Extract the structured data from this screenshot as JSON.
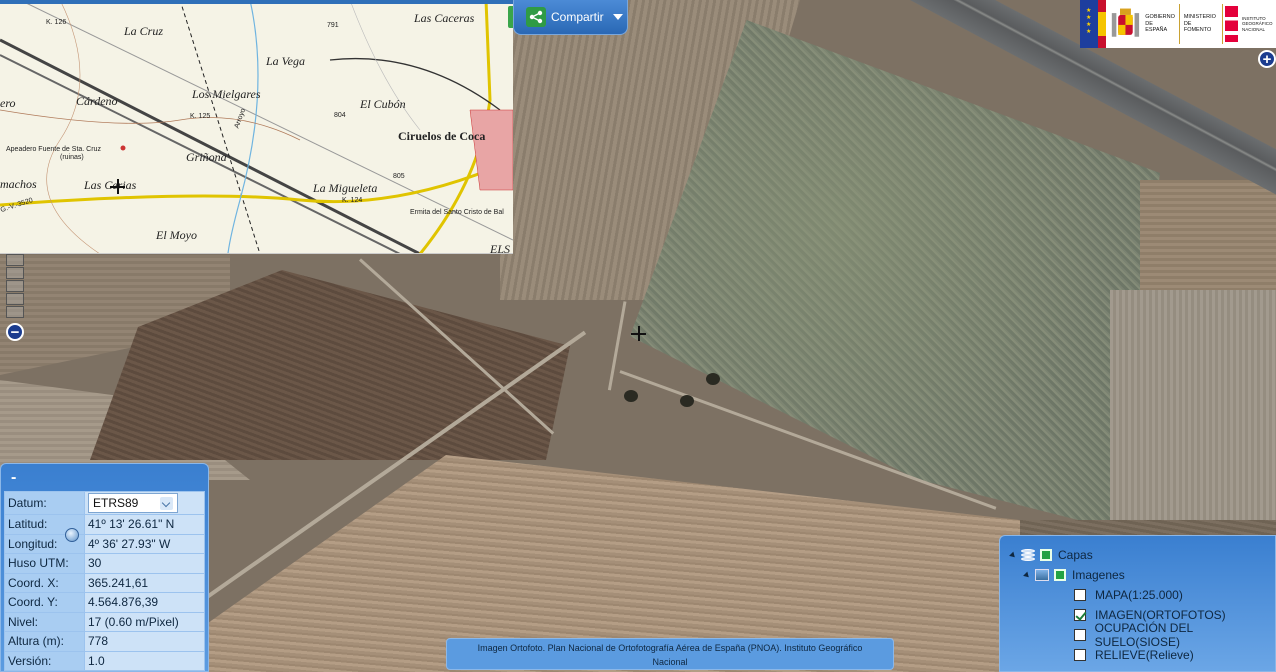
{
  "share": {
    "label": "Compartir",
    "icon": "share-icon"
  },
  "logos": {
    "gobierno": "GOBIERNO DE ESPAÑA",
    "ministerio": "MINISTERIO DE FOMENTO",
    "instituto": "INSTITUTO GEOGRÁFICO NACIONAL"
  },
  "zoom": {
    "in_label": "+",
    "out_label": "−"
  },
  "topo_labels": {
    "la_cruz": "La Cruz",
    "las_caceras": "Las Caceras",
    "la_vega": "La Vega",
    "los_mielgares": "Los Mielgares",
    "el_cubon": "El Cubón",
    "cardeno": "Cárdeno",
    "ciruelos": "Ciruelos de Coca",
    "apeadero": "Apeadero Fuente de Sta. Cruz",
    "ruinas": "(ruinas)",
    "grinona": "Griñona",
    "machos": "machos",
    "las_cerias": "Las Cerias",
    "la_migueleta": "La Migueleta",
    "el_moyo": "El Moyo",
    "ermita": "Ermita del Santo Cristo de Bal",
    "arroyo": "Arroyo",
    "els": "ELS",
    "ero": "ero",
    "k126": "K. 126",
    "k125": "K. 125",
    "k124": "K. 124",
    "h791": "791",
    "h804": "804",
    "h805": "805",
    "road_code": "G.-V.-3520"
  },
  "coords": {
    "toggle": "-",
    "datum_label": "Datum:",
    "datum_value": "ETRS89",
    "rows": [
      {
        "label": "Latitud:",
        "value": "41º 13' 26.61\" N"
      },
      {
        "label": "Longitud:",
        "value": "4º 36' 27.93\" W"
      },
      {
        "label": "Huso UTM:",
        "value": "30"
      },
      {
        "label": "Coord. X:",
        "value": "365.241,61"
      },
      {
        "label": "Coord. Y:",
        "value": "4.564.876,39"
      },
      {
        "label": "Nivel:",
        "value": "17 (0.60 m/Pixel)"
      },
      {
        "label": "Altura (m):",
        "value": "778"
      },
      {
        "label": "Versión:",
        "value": "1.0"
      }
    ]
  },
  "attribution": {
    "line1": "Imagen Ortofoto. Plan Nacional de Ortofotografía Aérea de España (PNOA). Instituto Geográfico",
    "line2": "Nacional"
  },
  "layers": {
    "root": "Capas",
    "group": "Imagenes",
    "items": [
      {
        "label": "MAPA(1:25.000)",
        "checked": false
      },
      {
        "label": "IMAGEN(ORTOFOTOS)",
        "checked": true
      },
      {
        "label": "OCUPACIÓN DEL SUELO(SIOSE)",
        "checked": false
      },
      {
        "label": "RELIEVE(Relieve)",
        "checked": false
      }
    ]
  }
}
